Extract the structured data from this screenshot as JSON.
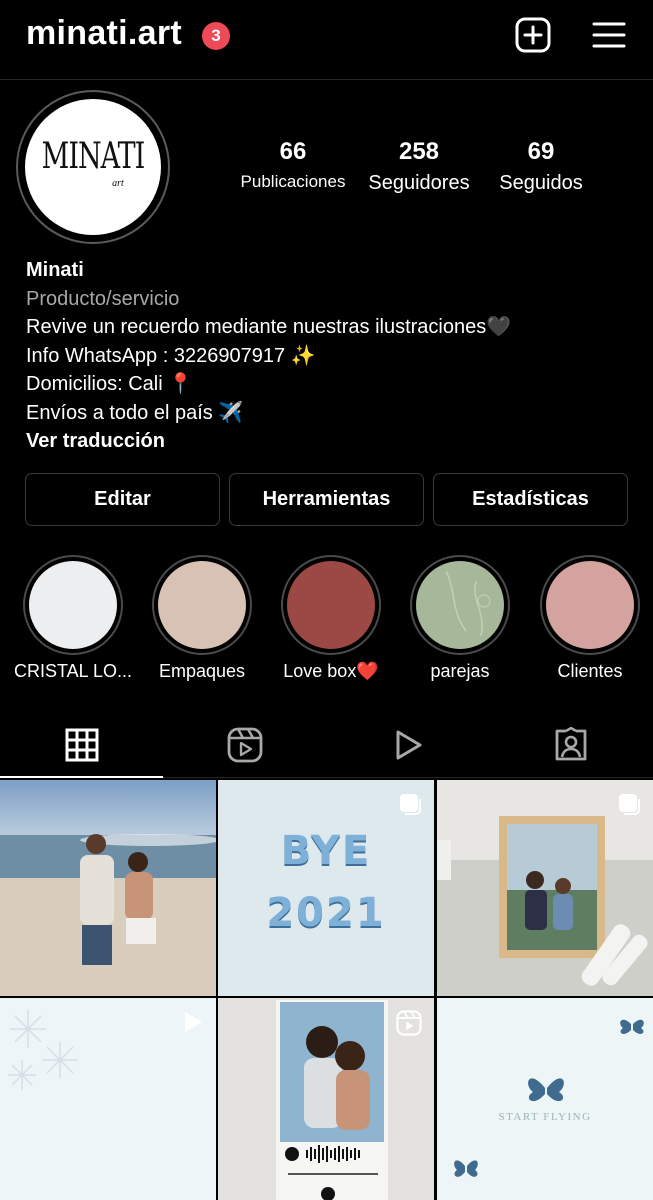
{
  "header": {
    "username": "minati.art",
    "notification_count": "3",
    "new_post_icon": "plus-square-icon",
    "menu_icon": "hamburger-menu-icon"
  },
  "profile": {
    "avatar_logo_text": "MINATI",
    "avatar_logo_sub": "art",
    "stats": [
      {
        "value": "66",
        "label": "Publicaciones"
      },
      {
        "value": "258",
        "label": "Seguidores"
      },
      {
        "value": "69",
        "label": "Seguidos"
      }
    ],
    "name": "Minati",
    "category": "Producto/servicio",
    "bio_lines": [
      "Revive un recuerdo mediante nuestras ilustraciones🖤",
      "Info WhatsApp : 3226907917 ✨",
      "Domicilios: Cali 📍",
      "Envíos a todo el país ✈️"
    ],
    "translate_link": "Ver traducción"
  },
  "actions": {
    "edit": "Editar",
    "tools": "Herramientas",
    "stats": "Estadísticas"
  },
  "highlights": [
    {
      "label": "CRISTAL LO...",
      "color": "#eceef0"
    },
    {
      "label": "Empaques",
      "color": "#d8c2b4"
    },
    {
      "label": "Love box❤️",
      "color": "#9c4844"
    },
    {
      "label": "parejas",
      "color": "#a7b79a"
    },
    {
      "label": "Clientes",
      "color": "#d4a3a0"
    }
  ],
  "tabs": [
    {
      "name": "grid-icon",
      "active": true
    },
    {
      "name": "reels-icon",
      "active": false
    },
    {
      "name": "video-play-icon",
      "active": false
    },
    {
      "name": "tagged-person-icon",
      "active": false
    }
  ],
  "grid_posts": {
    "post2_text_line1": "BYE",
    "post2_text_line2": "2021",
    "post6_text": "START FLYING"
  }
}
